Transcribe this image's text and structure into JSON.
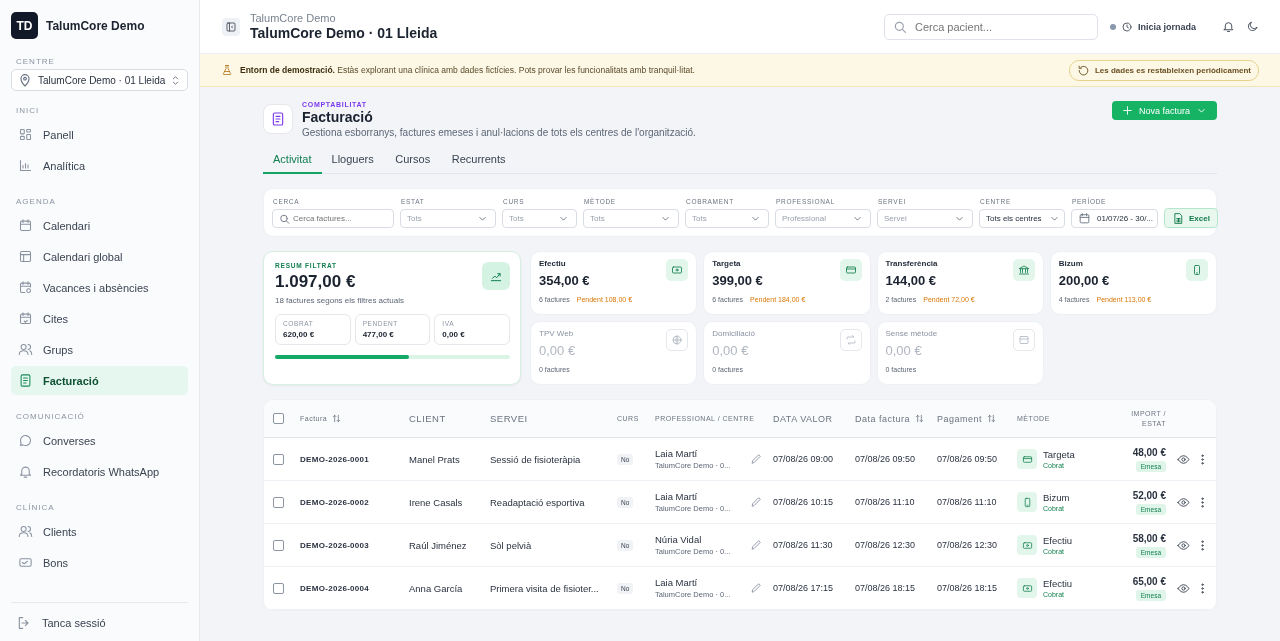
{
  "sidebar": {
    "brand": {
      "initials": "TD",
      "name": "TalumCore Demo"
    },
    "centre": {
      "label": "CENTRE",
      "value": "TalumCore Demo · 01 Lleida"
    },
    "sections": [
      {
        "title": "INICI",
        "items": [
          {
            "label": "Panell",
            "selected": false
          },
          {
            "label": "Analítica",
            "selected": false
          }
        ]
      },
      {
        "title": "AGENDA",
        "items": [
          {
            "label": "Calendari",
            "selected": false
          },
          {
            "label": "Calendari global",
            "selected": false
          },
          {
            "label": "Vacances i absències",
            "selected": false
          },
          {
            "label": "Cites",
            "selected": false
          },
          {
            "label": "Grups",
            "selected": false
          },
          {
            "label": "Facturació",
            "selected": true
          }
        ]
      },
      {
        "title": "COMUNICACIÓ",
        "items": [
          {
            "label": "Converses",
            "selected": false
          },
          {
            "label": "Recordatoris WhatsApp",
            "selected": false
          }
        ]
      },
      {
        "title": "CLÍNICA",
        "items": [
          {
            "label": "Clients",
            "selected": false
          },
          {
            "label": "Bons",
            "selected": false
          }
        ]
      }
    ],
    "logout": "Tanca sessió"
  },
  "header": {
    "breadcrumb": "TalumCore Demo",
    "title": "TalumCore Demo · 01 Lleida",
    "search": {
      "placeholder": "Cerca pacient..."
    },
    "shift": "Inicia jornada"
  },
  "banner": {
    "text": "**Entorn de demostració.** Estàs explorant una clínica amb dades fictícies. Pots provar les funcionalitats amb tranquil·litat.",
    "badge": "Les dades es restableixen periòdicament"
  },
  "page": {
    "eyebrow": "COMPTABILITAT",
    "title": "Facturació",
    "subtitle": "Gestiona esborranys, factures emeses i anul·lacions de tots els centres de l'organització.",
    "new_button": "Nova factura"
  },
  "tabs": [
    {
      "label": "Activitat",
      "selected": true
    },
    {
      "label": "Lloguers",
      "selected": false
    },
    {
      "label": "Cursos",
      "selected": false
    },
    {
      "label": "Recurrents",
      "selected": false
    }
  ],
  "filters": [
    {
      "label": "CERCA",
      "kind": "search",
      "placeholder": "Cerca factures..."
    },
    {
      "label": "ESTAT",
      "kind": "select",
      "placeholder": "Tots"
    },
    {
      "label": "CURS",
      "kind": "select",
      "placeholder": "Tots"
    },
    {
      "label": "MÈTODE",
      "kind": "select",
      "placeholder": "Tots"
    },
    {
      "label": "COBRAMENT",
      "kind": "select",
      "placeholder": "Tots"
    },
    {
      "label": "PROFESSIONAL",
      "kind": "select",
      "placeholder": "Professional"
    },
    {
      "label": "SERVEI",
      "kind": "select",
      "placeholder": "Servei"
    },
    {
      "label": "CENTRE",
      "kind": "select",
      "value": "Tots els centres"
    },
    {
      "label": "PERÍODE",
      "kind": "date",
      "value": "01/07/26 - 30/..."
    }
  ],
  "export_button": "Excel",
  "summary": {
    "label": "RESUM FILTRAT",
    "total": "1.097,00 €",
    "note": "18 factures segons els filtres actuals",
    "stats": [
      {
        "label": "COBRAT",
        "value": "620,00 €"
      },
      {
        "label": "PENDENT",
        "value": "477,00 €"
      },
      {
        "label": "IVA",
        "value": "0,00 €"
      }
    ],
    "level": 0.57
  },
  "methods": [
    {
      "kind": "cash",
      "name": "Efectiu",
      "amount": "354,00 €",
      "count": "6 factures",
      "pending": "Pendent 108,00 €",
      "active": true
    },
    {
      "kind": "card",
      "name": "Targeta",
      "amount": "399,00 €",
      "count": "6 factures",
      "pending": "Pendent 184,00 €",
      "active": true
    },
    {
      "kind": "bank",
      "name": "Transferència",
      "amount": "144,00 €",
      "count": "2 factures",
      "pending": "Pendent 72,00 €",
      "active": true
    },
    {
      "kind": "mobile",
      "name": "Bizum",
      "amount": "200,00 €",
      "count": "4 factures",
      "pending": "Pendent 113,00 €",
      "active": true
    },
    {
      "kind": "web",
      "name": "TPV Web",
      "amount": "0,00 €",
      "count": "0 factures",
      "active": false
    },
    {
      "kind": "debit",
      "name": "Domiciliació",
      "amount": "0,00 €",
      "count": "0 factures",
      "active": false
    },
    {
      "kind": "none",
      "name": "Sense mètode",
      "amount": "0,00 €",
      "count": "0 factures",
      "active": false
    }
  ],
  "table": {
    "all_checked": false,
    "columns": [
      {
        "label": "Factura",
        "sortable": true
      },
      {
        "label": "CLIENT",
        "sortable": false
      },
      {
        "label": "SERVEI",
        "sortable": false
      },
      {
        "label": "CURS",
        "sortable": false
      },
      {
        "label": "PROFESSIONAL / CENTRE",
        "sortable": false
      },
      {
        "label": "DATA VALOR",
        "sortable": false
      },
      {
        "label": "Data factura",
        "sortable": true
      },
      {
        "label": "Pagament",
        "sortable": true
      },
      {
        "label": "MÈTODE",
        "sortable": false
      },
      {
        "label": "IMPORT / ESTAT",
        "sortable": false
      }
    ],
    "rows": [
      {
        "number": "DEMO-2026-0001",
        "client": "Manel Prats",
        "service": "Sessió de fisioteràpia",
        "course": "No",
        "professional": "Laia Martí",
        "centre": "TalumCore Demo · 0...",
        "value_date": "07/08/26 09:00",
        "invoice_date": "07/08/26 09:50",
        "payment_date": "07/08/26 09:50",
        "method": {
          "kind": "card",
          "label": "Targeta",
          "collection": "Cobrat"
        },
        "amount": "48,00 €",
        "status": "Emesa",
        "checked": false
      },
      {
        "number": "DEMO-2026-0002",
        "client": "Irene Casals",
        "service": "Readaptació esportiva",
        "course": "No",
        "professional": "Laia Martí",
        "centre": "TalumCore Demo · 0...",
        "value_date": "07/08/26 10:15",
        "invoice_date": "07/08/26 11:10",
        "payment_date": "07/08/26 11:10",
        "method": {
          "kind": "mobile",
          "label": "Bizum",
          "collection": "Cobrat"
        },
        "amount": "52,00 €",
        "status": "Emesa",
        "checked": false
      },
      {
        "number": "DEMO-2026-0003",
        "client": "Raúl Jiménez",
        "service": "Sòl pelvià",
        "course": "No",
        "professional": "Núria Vidal",
        "centre": "TalumCore Demo · 0...",
        "value_date": "07/08/26 11:30",
        "invoice_date": "07/08/26 12:30",
        "payment_date": "07/08/26 12:30",
        "method": {
          "kind": "cash",
          "label": "Efectiu",
          "collection": "Cobrat"
        },
        "amount": "58,00 €",
        "status": "Emesa",
        "checked": false
      },
      {
        "number": "DEMO-2026-0004",
        "client": "Anna García",
        "service": "Primera visita de fisioter...",
        "course": "No",
        "professional": "Laia Martí",
        "centre": "TalumCore Demo · 0...",
        "value_date": "07/08/26 17:15",
        "invoice_date": "07/08/26 18:15",
        "payment_date": "07/08/26 18:15",
        "method": {
          "kind": "cash",
          "label": "Efectiu",
          "collection": "Cobrat"
        },
        "amount": "65,00 €",
        "status": "Emesa",
        "checked": false
      }
    ]
  }
}
